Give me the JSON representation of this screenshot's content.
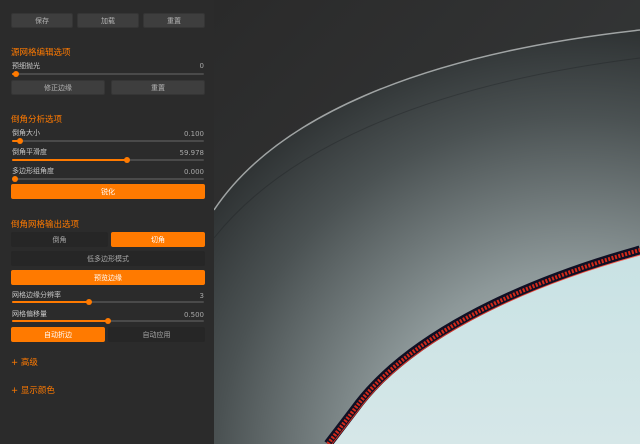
{
  "toolbar": {
    "save_label": "保存",
    "load_label": "加载",
    "reset_label": "重置"
  },
  "source_mesh": {
    "title": "源网格编辑选项",
    "smooth_label": "预细抛光",
    "smooth_value": "0",
    "smooth_fraction": 0.02,
    "fix_edges_label": "修正边缘",
    "reset_label": "重置"
  },
  "bevel_analysis": {
    "title": "倒角分析选项",
    "size_label": "倒角大小",
    "size_value": "0.100",
    "size_fraction": 0.04,
    "smoothness_label": "倒角平滑度",
    "smoothness_value": "59.978",
    "smoothness_fraction": 0.6,
    "polygon_angle_label": "多边形组角度",
    "polygon_angle_value": "0.000",
    "polygon_angle_fraction": 0.0,
    "sharpen_label": "锐化"
  },
  "bevel_output": {
    "title": "倒角网格输出选项",
    "tab_bevel": "倒角",
    "tab_chamfer": "切角",
    "low_poly_label": "低多边形模式",
    "preview_edges_label": "预览边缘",
    "resolution_label": "网格边缘分辨率",
    "resolution_value": "3",
    "resolution_fraction": 0.4,
    "offset_label": "网格偏移量",
    "offset_value": "0.500",
    "offset_fraction": 0.5,
    "auto_fold_label": "自动折边",
    "auto_apply_label": "自动应用"
  },
  "advanced": {
    "label": "+ 高级"
  },
  "display_colors": {
    "label": "+ 显示颜色"
  },
  "colors": {
    "accent": "#ff7a00",
    "panel": "#2b2b2b"
  }
}
